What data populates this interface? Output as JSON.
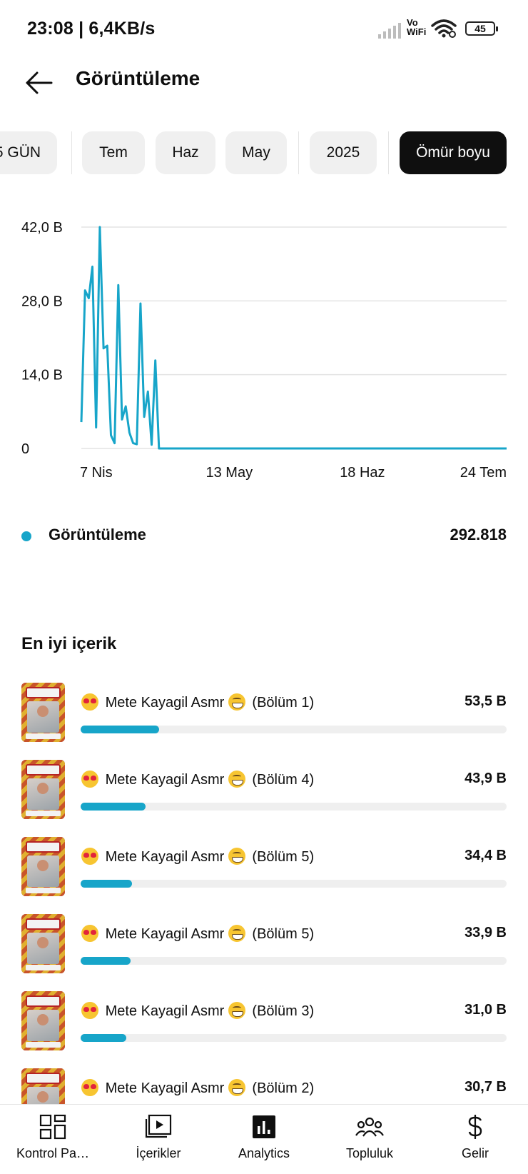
{
  "status_bar": {
    "time_speed": "23:08 | 6,4KB/s",
    "vowifi_top": "Vo",
    "vowifi_bottom": "WiFi",
    "battery": "45"
  },
  "header": {
    "title": "Görüntüleme"
  },
  "filters": {
    "chips": [
      {
        "label": "5 GÜN",
        "active": false
      },
      {
        "label": "Tem",
        "active": false
      },
      {
        "label": "Haz",
        "active": false
      },
      {
        "label": "May",
        "active": false
      },
      {
        "label": "2025",
        "active": false
      },
      {
        "label": "Ömür boyu",
        "active": true
      }
    ]
  },
  "chart_data": {
    "type": "line",
    "title": "",
    "xlabel": "",
    "ylabel": "",
    "y_ticks": [
      "42,0 B",
      "28,0 B",
      "14,0 B",
      "0"
    ],
    "x_ticks": [
      "7 Nis",
      "13 May",
      "18 Haz",
      "24 Tem"
    ],
    "ylim": [
      0,
      42000
    ],
    "grid": true,
    "series_color": "#17a5c9",
    "x_tick_positions_days": [
      4,
      40,
      76,
      112
    ],
    "y": [
      5000,
      30000,
      28500,
      34500,
      4000,
      42000,
      19000,
      19500,
      2500,
      1000,
      31000,
      5500,
      8000,
      3000,
      1000,
      800,
      27500,
      6000,
      10800,
      700,
      16700,
      0,
      0,
      0,
      0,
      0,
      0,
      0,
      0,
      0,
      0,
      0,
      0,
      0,
      0,
      0,
      0,
      0,
      0,
      0,
      0,
      0,
      0,
      0,
      0,
      0,
      0,
      0,
      0,
      0,
      0,
      0,
      0,
      0,
      0,
      0,
      0,
      0,
      0,
      0,
      0,
      0,
      0,
      0,
      0,
      0,
      0,
      0,
      0,
      0,
      0,
      0,
      0,
      0,
      0,
      0,
      0,
      0,
      0,
      0,
      0,
      0,
      0,
      0,
      0,
      0,
      0,
      0,
      0,
      0,
      0,
      0,
      0,
      0,
      0,
      0,
      0,
      0,
      0,
      0,
      0,
      0,
      0,
      0,
      0,
      0,
      0,
      0,
      0,
      0,
      0,
      0,
      0,
      0,
      0,
      0
    ]
  },
  "summary": {
    "label": "Görüntüleme",
    "value": "292.818",
    "dot_color": "#17a5c9"
  },
  "top_content": {
    "title": "En iyi içerik",
    "items": [
      {
        "text": "Mete Kayagil Asmr",
        "episode": "(Bölüm 1)",
        "value": "53,5 B",
        "fraction": 0.185
      },
      {
        "text": "Mete Kayagil Asmr",
        "episode": "(Bölüm 4)",
        "value": "43,9 B",
        "fraction": 0.152
      },
      {
        "text": "Mete Kayagil Asmr",
        "episode": "(Bölüm 5)",
        "value": "34,4 B",
        "fraction": 0.12
      },
      {
        "text": "Mete Kayagil Asmr",
        "episode": "(Bölüm 5)",
        "value": "33,9 B",
        "fraction": 0.118
      },
      {
        "text": "Mete Kayagil Asmr",
        "episode": "(Bölüm 3)",
        "value": "31,0 B",
        "fraction": 0.108
      },
      {
        "text": "Mete Kayagil Asmr",
        "episode": "(Bölüm 2)",
        "value": "30,7 B",
        "fraction": 0.107
      }
    ]
  },
  "bottom_nav": {
    "items": [
      {
        "label": "Kontrol Pa…",
        "icon": "dashboard-icon"
      },
      {
        "label": "İçerikler",
        "icon": "content-icon"
      },
      {
        "label": "Analytics",
        "icon": "analytics-icon"
      },
      {
        "label": "Topluluk",
        "icon": "community-icon"
      },
      {
        "label": "Gelir",
        "icon": "dollar-icon"
      }
    ]
  }
}
